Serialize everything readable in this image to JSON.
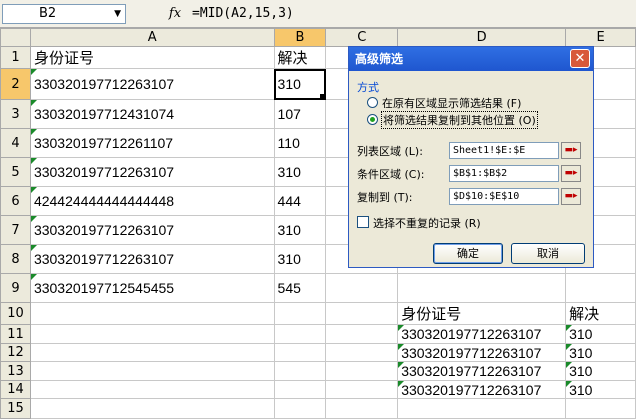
{
  "formula_bar": {
    "name_box": "B2",
    "fx": "fx",
    "formula": "=MID(A2,15,3)"
  },
  "columns": [
    "A",
    "B",
    "C",
    "D",
    "E"
  ],
  "rows": [
    {
      "n": "1",
      "a": "身份证号",
      "b": "解决",
      "d": "",
      "e": ""
    },
    {
      "n": "2",
      "a": "330320197712263107",
      "b": "310",
      "d": "",
      "e": ""
    },
    {
      "n": "3",
      "a": "330320197712431074",
      "b": "107",
      "d": "",
      "e": ""
    },
    {
      "n": "4",
      "a": "330320197712261107",
      "b": "110",
      "d": "",
      "e": ""
    },
    {
      "n": "5",
      "a": "330320197712263107",
      "b": "310",
      "d": "",
      "e": ""
    },
    {
      "n": "6",
      "a": "424424444444444448",
      "b": "444",
      "d": "",
      "e": ""
    },
    {
      "n": "7",
      "a": "330320197712263107",
      "b": "310",
      "d": "",
      "e": ""
    },
    {
      "n": "8",
      "a": "330320197712263107",
      "b": "310",
      "d": "",
      "e": ""
    },
    {
      "n": "9",
      "a": "330320197712545455",
      "b": "545",
      "d": "",
      "e": ""
    },
    {
      "n": "10",
      "a": "",
      "b": "",
      "d": "身份证号",
      "e": "解决"
    },
    {
      "n": "11",
      "a": "",
      "b": "",
      "d": "330320197712263107",
      "e": "310"
    },
    {
      "n": "12",
      "a": "",
      "b": "",
      "d": "330320197712263107",
      "e": "310"
    },
    {
      "n": "13",
      "a": "",
      "b": "",
      "d": "330320197712263107",
      "e": "310"
    },
    {
      "n": "14",
      "a": "",
      "b": "",
      "d": "330320197712263107",
      "e": "310"
    },
    {
      "n": "15",
      "a": "",
      "b": "",
      "d": "",
      "e": ""
    }
  ],
  "dialog": {
    "title": "高级筛选",
    "close": "✕",
    "group_label": "方式",
    "radio1": "在原有区域显示筛选结果 (F)",
    "radio2": "将筛选结果复制到其他位置 (O)",
    "list_range_label": "列表区域 (L):",
    "list_range_value": "Sheet1!$E:$E",
    "criteria_label": "条件区域 (C):",
    "criteria_value": "$B$1:$B$2",
    "copy_to_label": "复制到 (T):",
    "copy_to_value": "$D$10:$E$10",
    "unique_label": "选择不重复的记录 (R)",
    "ok": "确定",
    "cancel": "取消"
  },
  "colors": {
    "selected_header": "#f7c76b",
    "title_bar": "#2f6fe3",
    "error_triangle": "#1a8a2a"
  },
  "icons": [
    "dropdown-arrow-icon",
    "fx-icon",
    "close-icon",
    "range-collapse-icon"
  ]
}
